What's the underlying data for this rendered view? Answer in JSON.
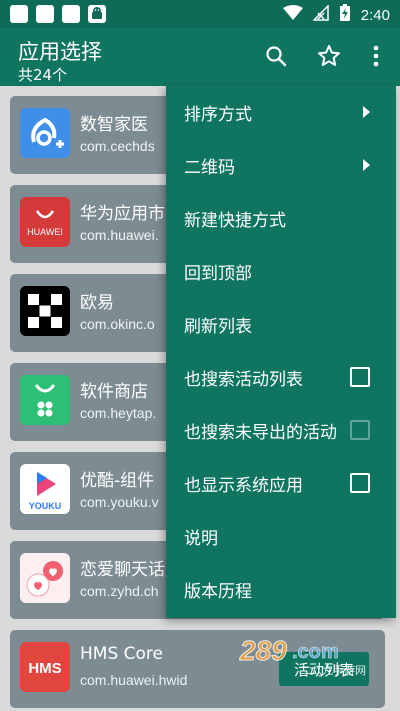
{
  "status_bar": {
    "time": "2:40",
    "notification_app_icon": "android-robot-icon"
  },
  "app_bar": {
    "title": "应用选择",
    "subtitle": "共24个",
    "icons": [
      "search-icon",
      "star-outline-icon",
      "more-vert-icon"
    ]
  },
  "apps": [
    {
      "name": "数智家医",
      "package": "com.cechds",
      "icon": "shuzhi-app-icon",
      "icon_color": "#3f8ee8"
    },
    {
      "name": "华为应用市",
      "package": "com.huawei.",
      "icon": "huawei-appgallery-icon",
      "icon_color": "#d43a3a",
      "icon_text": "HUAWEI"
    },
    {
      "name": "欧易",
      "package": "com.okinc.o",
      "icon": "okx-icon",
      "icon_color": "#000000"
    },
    {
      "name": "软件商店",
      "package": "com.heytap.",
      "icon": "software-store-icon",
      "icon_color": "#2dbf75"
    },
    {
      "name": "优酷-组件",
      "package": "com.youku.v",
      "icon": "youku-icon",
      "icon_color": "#2a7df0",
      "icon_text": "YOUKU"
    },
    {
      "name": "恋爱聊天话",
      "package": "com.zyhd.ch",
      "icon": "chat-love-icon",
      "icon_color": "#f0606e"
    },
    {
      "name": "HMS Core",
      "package": "com.huawei.hwid",
      "icon": "hms-icon",
      "icon_color": "#e0453e",
      "icon_text": "HMS"
    }
  ],
  "hms_button_label": "活动列表",
  "menu": {
    "items": [
      {
        "label": "排序方式",
        "type": "submenu"
      },
      {
        "label": "二维码",
        "type": "submenu"
      },
      {
        "label": "新建快捷方式",
        "type": "action"
      },
      {
        "label": "回到顶部",
        "type": "action"
      },
      {
        "label": "刷新列表",
        "type": "action"
      },
      {
        "label": "也搜索活动列表",
        "type": "checkbox",
        "checked": false,
        "enabled": true
      },
      {
        "label": "也搜索未导出的活动",
        "type": "checkbox",
        "checked": false,
        "enabled": false
      },
      {
        "label": "也显示系统应用",
        "type": "checkbox",
        "checked": false,
        "enabled": true
      },
      {
        "label": "说明",
        "type": "action"
      },
      {
        "label": "版本历程",
        "type": "action"
      }
    ]
  },
  "watermark": {
    "logo": "289",
    "domain": ".com",
    "site": "二八九手游网"
  },
  "colors": {
    "primary": "#0f7561",
    "status_bar": "#0d6b58",
    "card": "#7d8c92"
  }
}
